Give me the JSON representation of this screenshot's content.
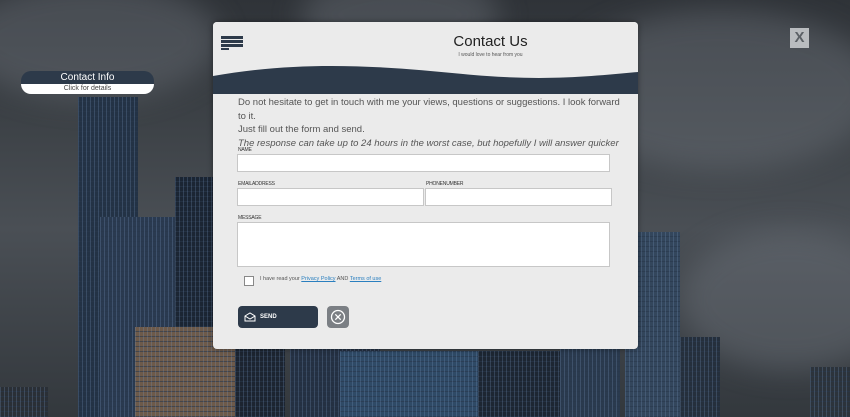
{
  "header": {
    "title": "Contact Us",
    "subtitle": "I would love to hear from you"
  },
  "side_tab": {
    "title": "Contact Info",
    "subtitle": "Click for details"
  },
  "close_label": "X",
  "intro": {
    "line1": "Do not hesitate to get in touch with me your views, questions or suggestions. I look forward to it.",
    "line2": "Just fill out the form and send.",
    "line3": "The response can take up to 24 hours in the worst case, but hopefully I will answer quicker"
  },
  "form": {
    "name_label": "NAME",
    "email_label": "EMAILADDRESS",
    "phone_label": "PHONENUMBER",
    "message_label": "MESSAGE",
    "name_value": "",
    "email_value": "",
    "phone_value": "",
    "message_value": "",
    "agree_prefix": "I have read your",
    "privacy_link": "Privacy Policy",
    "agree_and": "AND",
    "terms_link": "Terms of use",
    "agree_checked": false,
    "send_label": "SEND"
  },
  "icons": {
    "menu": "menu-icon",
    "send": "envelope-icon",
    "cancel": "cancel-circle-icon",
    "close": "close-icon"
  },
  "colors": {
    "accent": "#2d3a4a",
    "link": "#2a7fbf",
    "panel": "#ebebeb",
    "cancel": "#7b7f84"
  }
}
